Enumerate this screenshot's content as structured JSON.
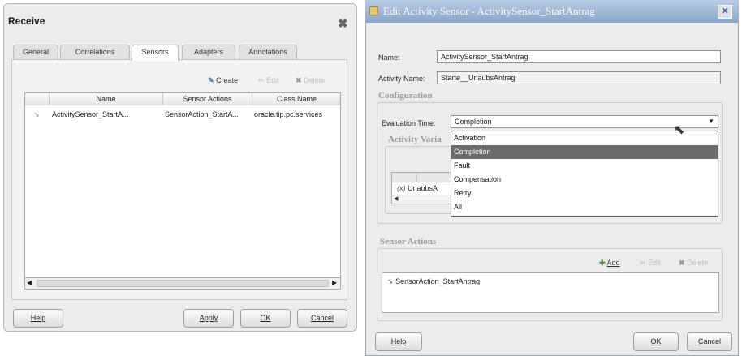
{
  "receive": {
    "title": "Receive",
    "tabs": [
      "General",
      "Correlations",
      "Sensors",
      "Adapters",
      "Annotations"
    ],
    "toolbar": {
      "create": "Create",
      "edit": "Edit",
      "delete": "Delete"
    },
    "columns": [
      "Name",
      "Sensor Actions",
      "Class Name"
    ],
    "rows": [
      {
        "name": "ActivitySensor_StartA...",
        "actions": "SensorAction_StartA...",
        "class": "oracle.tip.pc.services"
      }
    ],
    "buttons": {
      "help": "Help",
      "apply": "Apply",
      "ok": "OK",
      "cancel": "Cancel"
    }
  },
  "edit_sensor": {
    "title": "Edit Activity Sensor - ActivitySensor_StartAntrag",
    "name_label": "Name:",
    "name_value": "ActivitySensor_StartAntrag",
    "activity_label": "Activity Name:",
    "activity_value": "Starte__UrlaubsAntrag",
    "configuration_title": "Configuration",
    "evaluation_label": "Evaluation Time:",
    "evaluation_value": "Completion",
    "activity_variables_title": "Activity Varia",
    "var_row_label": "UrlaubsA",
    "var_icon": "(x)",
    "evaluation_options": [
      "Activation",
      "Completion",
      "Fault",
      "Compensation",
      "Retry",
      "All"
    ],
    "selected_option": "Completion",
    "sensor_actions_title": "Sensor Actions",
    "toolbar": {
      "add": "Add",
      "edit": "Edit",
      "delete": "Delete"
    },
    "sensor_action_item": "SensorAction_StartAntrag",
    "buttons": {
      "help": "Help",
      "ok": "OK",
      "cancel": "Cancel"
    }
  }
}
